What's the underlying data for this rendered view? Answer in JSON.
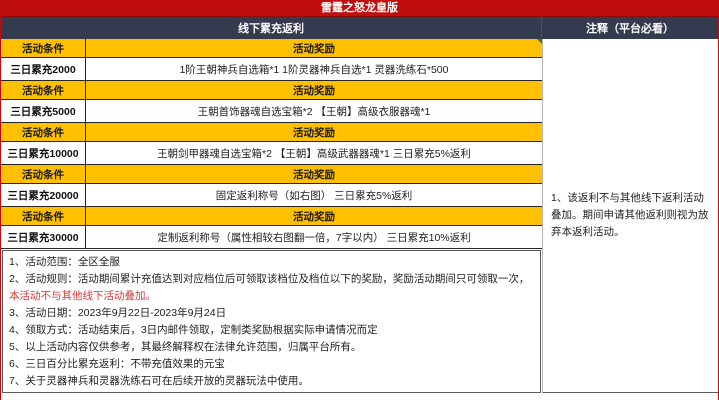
{
  "page": {
    "title": "雷霆之怒龙皇版"
  },
  "headers": {
    "left_section": "线下累充返利",
    "right_section": "注释（平台必看）"
  },
  "table": {
    "condition_header": "活动条件",
    "reward_header": "活动奖励",
    "tiers": [
      {
        "condition": "三日累充2000",
        "reward": "1阶王朝神兵自选箱*1 1阶灵器神兵自选*1 灵器洗练石*500"
      },
      {
        "condition": "三日累充5000",
        "reward": "王朝首饰器魂自选宝箱*2 【王朝】高级衣服器魂*1"
      },
      {
        "condition": "三日累充10000",
        "reward": "王朝剑甲器魂自选宝箱*2 【王朝】高级武器器魂*1 三日累充5%返利"
      },
      {
        "condition": "三日累充20000",
        "reward": "固定返利称号（如右图） 三日累充5%返利"
      },
      {
        "condition": "三日累充30000",
        "reward": "定制返利称号（属性相较右图翻一倍，7字以内） 三日累充10%返利"
      }
    ]
  },
  "notes": [
    {
      "text": "1、活动范围：全区全服"
    },
    {
      "text": "2、活动规则：活动期间累计充值达到对应档位后可领取该档位及档位以下的奖励，奖励活动期间只可领取一次，",
      "red": "本活动不与其他线下活动叠加。"
    },
    {
      "text": "3、活动日期：2023年9月22日-2023年9月24日"
    },
    {
      "text": "4、领取方式：活动结束后，3日内邮件领取，定制类奖励根据实际申请情况而定"
    },
    {
      "text": "5、以上活动内容仅供参考，其最终解释权在法律允许范围，归属平台所有。"
    },
    {
      "text": "6、三日百分比累充返利：不带充值效果的元宝"
    },
    {
      "text": "7、关于灵器神兵和灵器洗练石可在后续开放的灵器玩法中使用。"
    }
  ],
  "side_note": "1、该返利不与其他线下返利活动叠加。期间申请其他返利则视为放弃本返利活动。",
  "colors": {
    "banner_red": "#c00d0d",
    "header_navy": "#353b4e",
    "tier_gold": "#ffc000",
    "warning_red_text": "#d23a3a",
    "outer_border_red": "#b50f0f"
  },
  "icons": {
    "comment_marker": "green-corner-triangle"
  }
}
